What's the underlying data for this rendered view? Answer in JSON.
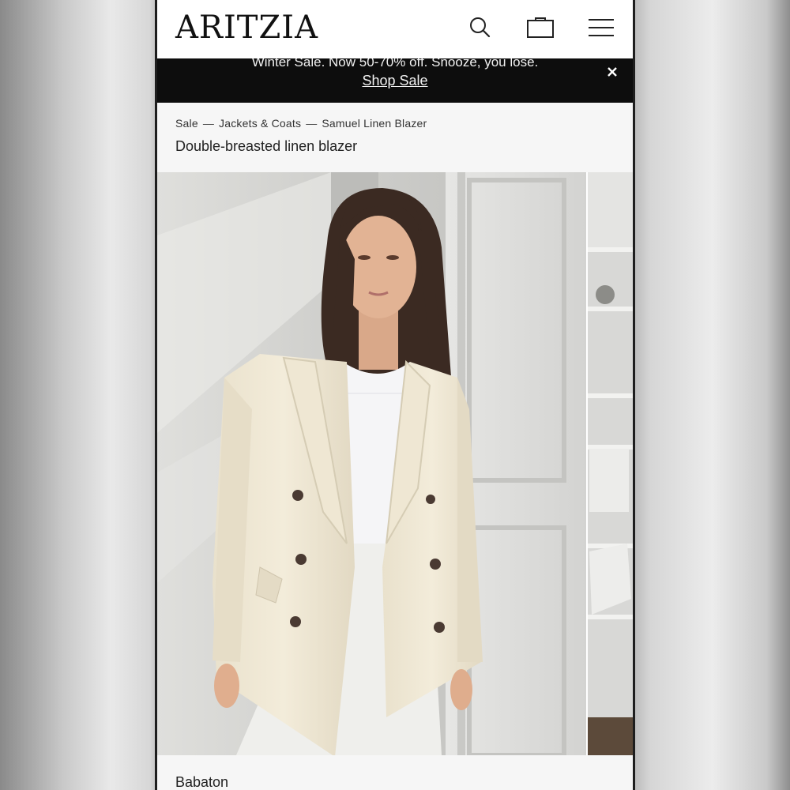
{
  "header": {
    "logo": "ARITZIA",
    "icons": [
      "search-icon",
      "shopping-bag-icon",
      "menu-icon"
    ]
  },
  "banner": {
    "text": "Winter Sale. Now 50-70% off. Snooze, you lose.",
    "link": "Shop Sale",
    "close_icon": "close-icon"
  },
  "breadcrumb": {
    "items": [
      "Sale",
      "Jackets & Coats",
      "Samuel Linen Blazer"
    ],
    "separator": "—"
  },
  "product": {
    "subtitle": "Double-breasted linen blazer",
    "brand": "Babaton"
  },
  "colors": {
    "banner_bg": "#0d0d0d",
    "page_bg": "#ffffff",
    "crumb_bg": "#f6f6f6",
    "blazer": "#eee6d2"
  }
}
